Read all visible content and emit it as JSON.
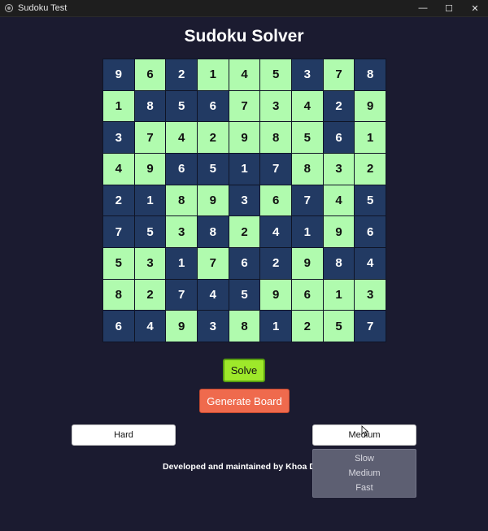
{
  "window": {
    "title": "Sudoku Test",
    "controls": [
      "—",
      "☐",
      "✕"
    ]
  },
  "page_title": "Sudoku Solver",
  "board": [
    [
      9,
      6,
      2,
      1,
      4,
      5,
      3,
      7,
      8
    ],
    [
      1,
      8,
      5,
      6,
      7,
      3,
      4,
      2,
      9
    ],
    [
      3,
      7,
      4,
      2,
      9,
      8,
      5,
      6,
      1
    ],
    [
      4,
      9,
      6,
      5,
      1,
      7,
      8,
      3,
      2
    ],
    [
      2,
      1,
      8,
      9,
      3,
      6,
      7,
      4,
      5
    ],
    [
      7,
      5,
      3,
      8,
      2,
      4,
      1,
      9,
      6
    ],
    [
      5,
      3,
      1,
      7,
      6,
      2,
      9,
      8,
      4
    ],
    [
      8,
      2,
      7,
      4,
      5,
      9,
      6,
      1,
      3
    ],
    [
      6,
      4,
      9,
      3,
      8,
      1,
      2,
      5,
      7
    ]
  ],
  "board_shading": [
    "DLDLLLDLD",
    "LDDDLLLDL",
    "DLLLLLLDL",
    "LLDDDDLLL",
    "DDLLDLDLD",
    "DDLDLDDLD",
    "LLDLDDLDD",
    "LLDDDLLLL",
    "DDLDLDLLD"
  ],
  "colors": {
    "dark_cell": "#223a63",
    "light_cell": "#b0fbae",
    "solve": "#9ee82a",
    "generate": "#ef6a4d",
    "background": "#1b1b30"
  },
  "buttons": {
    "solve": "Solve",
    "generate": "Generate Board"
  },
  "difficulty_select": {
    "value": "Hard"
  },
  "speed_select": {
    "value": "Medium",
    "options": [
      "Slow",
      "Medium",
      "Fast"
    ]
  },
  "footer": {
    "text": "Developed and maintained by Khoa Doan",
    "icon": "heart-icon"
  }
}
